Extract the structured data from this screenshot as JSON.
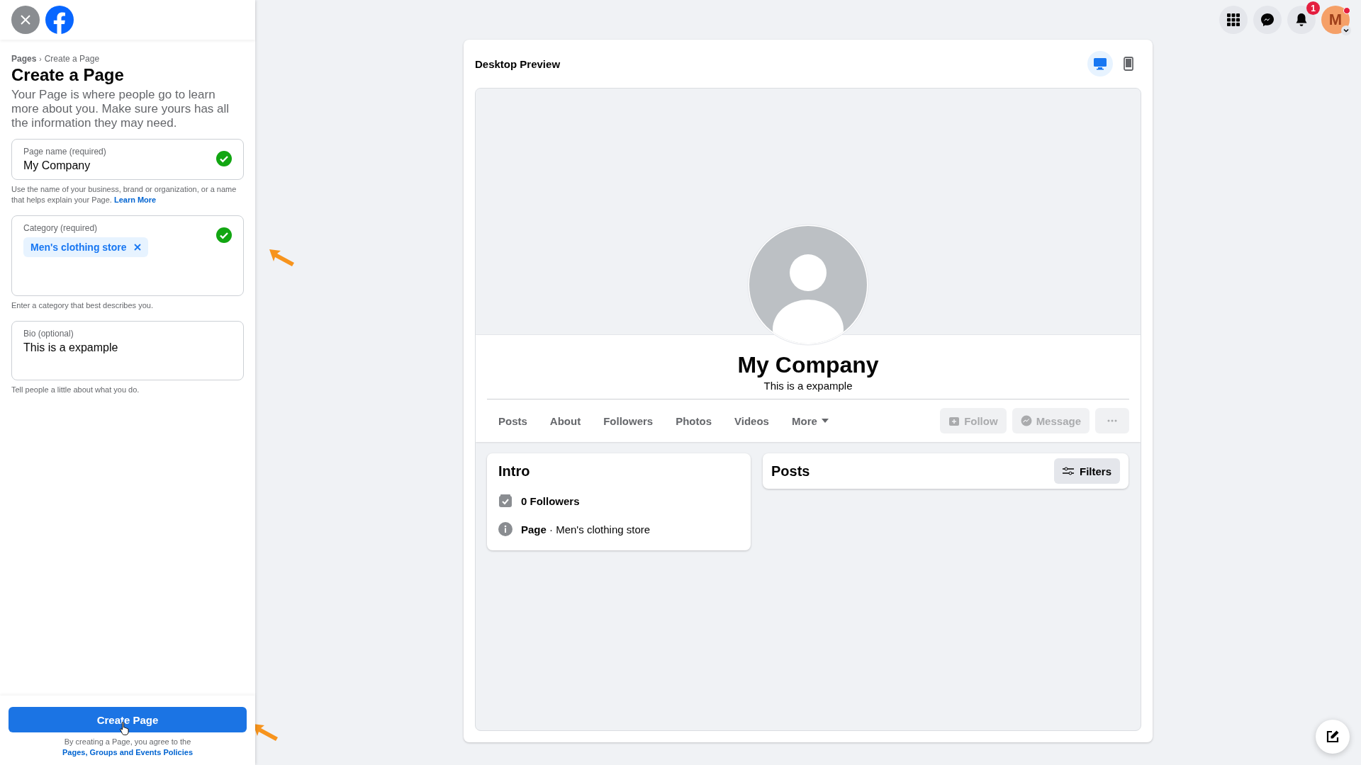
{
  "top_bar": {
    "notification_count": "1",
    "avatar_initial": "M"
  },
  "breadcrumb": [
    "Pages",
    "Create a Page"
  ],
  "breadcrumb_separator": "›",
  "title": "Create a Page",
  "description": "Your Page is where people go to learn more about you. Make sure yours has all the information they may need.",
  "fields": [
    {
      "kind": "text",
      "label": "Page name (required)",
      "value": "My Company",
      "valid": true,
      "help": "Use the name of your business, brand or organization, or a name that helps explain your Page.",
      "help_link": "Learn More"
    },
    {
      "kind": "chips",
      "label": "Category (required)",
      "chips": [
        "Men's clothing store"
      ],
      "valid": true,
      "help": "Enter a category that best describes you."
    },
    {
      "kind": "textarea",
      "label": "Bio (optional)",
      "value": "This is a expample",
      "help": "Tell people a little about what you do."
    }
  ],
  "create_button": "Create Page",
  "terms": {
    "text": "By creating a Page, you agree to the",
    "link": "Pages, Groups and Events Policies"
  },
  "preview": {
    "title": "Desktop Preview",
    "devices": [
      {
        "kind": "desktop",
        "selected": true
      },
      {
        "kind": "mobile",
        "selected": false
      }
    ],
    "page_name": "My Company",
    "bio": "This is a expample",
    "tabs": [
      "Posts",
      "About",
      "Followers",
      "Photos",
      "Videos",
      "More"
    ],
    "actions": [
      {
        "kind": "follow",
        "label": "Follow",
        "disabled": true
      },
      {
        "kind": "message",
        "label": "Message",
        "disabled": true
      },
      {
        "kind": "more",
        "disabled": true
      }
    ],
    "intro": {
      "title": "Intro",
      "items": [
        {
          "kind": "followers",
          "text": "**0 Followers**"
        },
        {
          "kind": "category",
          "text": "**Page** · Men's clothing store"
        }
      ]
    },
    "posts": {
      "title": "Posts",
      "filter_button": "Filters"
    }
  }
}
